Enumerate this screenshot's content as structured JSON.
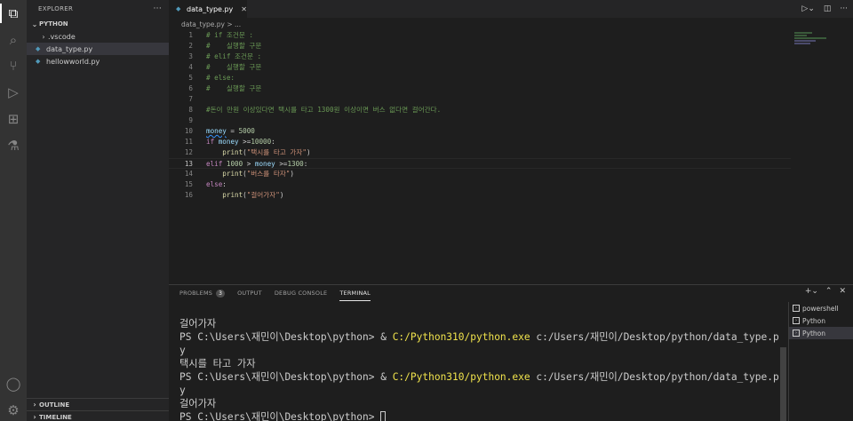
{
  "activity_bar": {
    "items": [
      {
        "name": "explorer-icon",
        "glyph": "⧉"
      },
      {
        "name": "search-icon",
        "glyph": "⌕"
      },
      {
        "name": "source-control-icon",
        "glyph": "⑂"
      },
      {
        "name": "run-debug-icon",
        "glyph": "▷"
      },
      {
        "name": "extensions-icon",
        "glyph": "⊞"
      },
      {
        "name": "testing-icon",
        "glyph": "⚗"
      }
    ],
    "bottom": [
      {
        "name": "account-icon",
        "glyph": "◯"
      },
      {
        "name": "settings-gear-icon",
        "glyph": "⚙"
      }
    ]
  },
  "sidebar": {
    "title": "EXPLORER",
    "more": "···",
    "folder": "PYTHON",
    "items": [
      {
        "label": ".vscode",
        "type": "folder"
      },
      {
        "label": "data_type.py",
        "type": "python",
        "selected": true
      },
      {
        "label": "hellowworld.py",
        "type": "python"
      }
    ],
    "outline": "OUTLINE",
    "timeline": "TIMELINE"
  },
  "editor": {
    "tab_label": "data_type.py",
    "breadcrumb": "data_type.py > ...",
    "lines": [
      "# if 조건문 :",
      "#    실행할 구문",
      "# elif 조건문 :",
      "#    실행할 구문",
      "# else:",
      "#    실행할 구문",
      "",
      "#돈이 만원 이상있다면 택시를 타고 1300원 이상이면 버스 없다면 걸어간다.",
      "",
      "money = 5000",
      "if money >=10000:",
      "    print(\"택시를 타고 가자\")",
      "elif 1000 > money >=1300:",
      "    print(\"버스를 타자\")",
      "else:",
      "    print(\"걸어가자\")"
    ],
    "current_line": 13
  },
  "panel": {
    "tabs": [
      "PROBLEMS",
      "OUTPUT",
      "DEBUG CONSOLE",
      "TERMINAL"
    ],
    "problems_count": "3",
    "active_tab": "TERMINAL",
    "terminal_lines": [
      {
        "text": "걸어가자"
      },
      {
        "prompt": "PS C:\\Users\\재민이\\Desktop\\python> & ",
        "exe": "C:/Python310/python.exe",
        "rest": " c:/Users/재민이/Desktop/python/data_type.p"
      },
      {
        "text": "y"
      },
      {
        "text": "택시를 타고 가자"
      },
      {
        "prompt": "PS C:\\Users\\재민이\\Desktop\\python> & ",
        "exe": "C:/Python310/python.exe",
        "rest": " c:/Users/재민이/Desktop/python/data_type.p"
      },
      {
        "text": "y"
      },
      {
        "text": "걸어가자"
      },
      {
        "prompt": "PS C:\\Users\\재민이\\Desktop\\python> ",
        "cursor": true
      }
    ],
    "terminals": [
      {
        "label": "powershell"
      },
      {
        "label": "Python"
      },
      {
        "label": "Python",
        "selected": true
      }
    ]
  }
}
